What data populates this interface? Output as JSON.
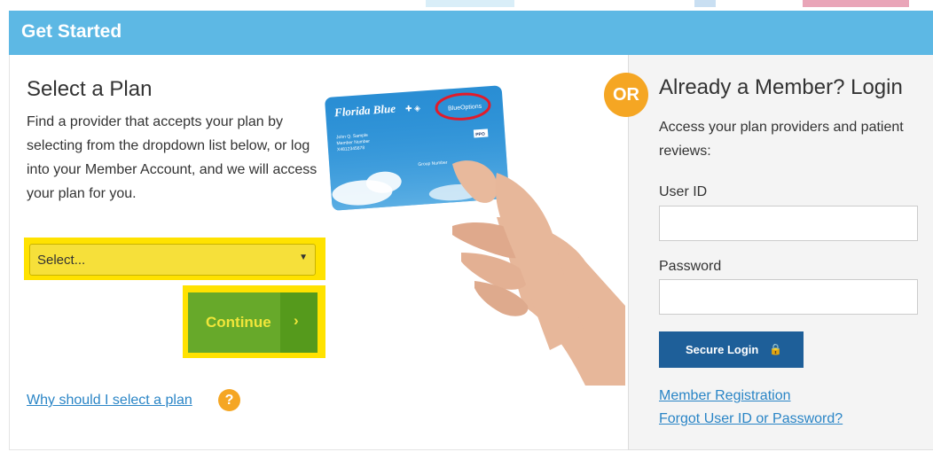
{
  "header": {
    "title": "Get Started"
  },
  "select_plan": {
    "heading": "Select a Plan",
    "description": "Find a provider that accepts your plan by selecting from the dropdown list below, or log into your Member Account, and we will access your plan for you.",
    "dropdown_value": "Select...",
    "continue_label": "Continue",
    "continue_arrow": "›",
    "why_link": "Why should I select a plan",
    "help_icon_glyph": "?"
  },
  "card": {
    "brand": "Florida Blue",
    "plan": "BlueOptions",
    "name_lines": [
      "John Q. Sample",
      "Member Number",
      "X4812345678"
    ],
    "badge": "PPO",
    "group": "Group Number"
  },
  "login": {
    "or_badge": "OR",
    "heading": "Already a Member? Login",
    "description": "Access your plan providers and patient reviews:",
    "user_label": "User ID",
    "user_value": "",
    "password_label": "Password",
    "password_value": "",
    "login_button": "Secure Login",
    "lock_glyph": "🔒",
    "register_link": "Member Registration",
    "forgot_link": "Forgot User ID or Password?"
  },
  "colors": {
    "header_bg": "#5db8e4",
    "highlight": "#ffe200",
    "continue_bg": "#67a92a",
    "login_bg": "#1e5f99",
    "link": "#2a85c6",
    "orange": "#f5a623"
  },
  "icons": {
    "help": "question-circle-icon",
    "caret": "caret-down-icon",
    "lock": "lock-icon",
    "arrow": "chevron-right-icon"
  }
}
